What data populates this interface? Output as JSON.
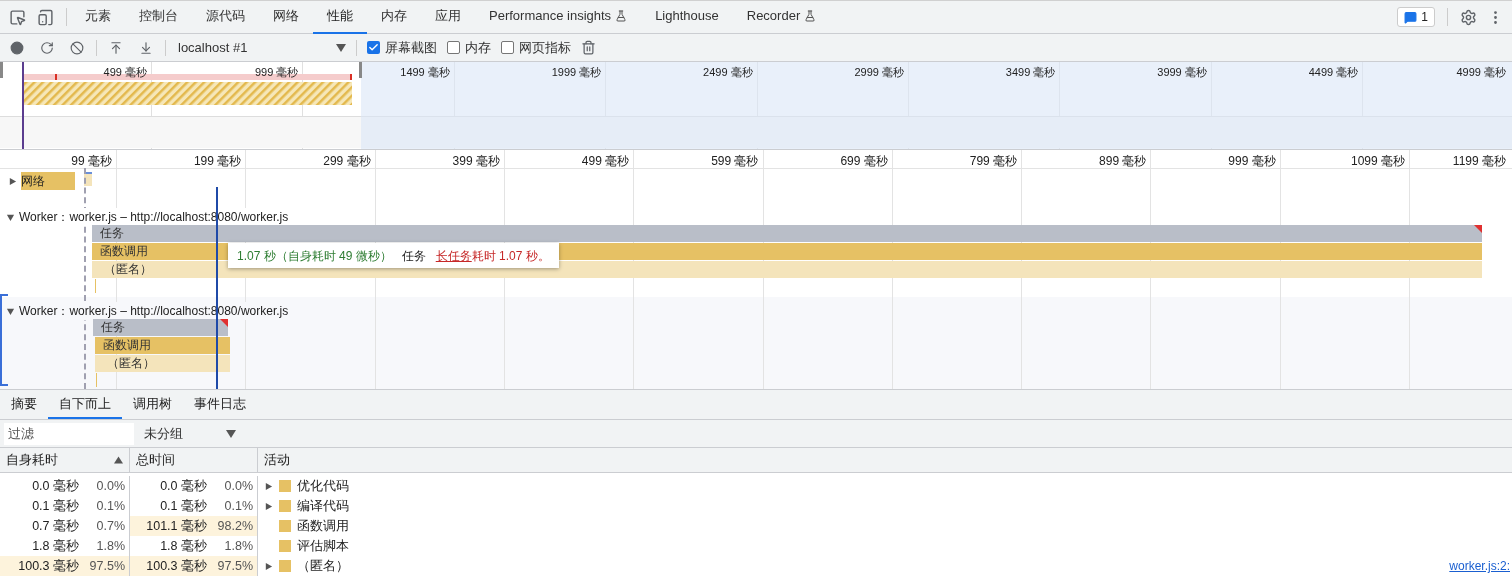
{
  "panel_tabs": [
    {
      "label": "元素",
      "selected": false,
      "experimental": false
    },
    {
      "label": "控制台",
      "selected": false,
      "experimental": false
    },
    {
      "label": "源代码",
      "selected": false,
      "experimental": false
    },
    {
      "label": "网络",
      "selected": false,
      "experimental": false
    },
    {
      "label": "性能",
      "selected": true,
      "experimental": false
    },
    {
      "label": "内存",
      "selected": false,
      "experimental": false
    },
    {
      "label": "应用",
      "selected": false,
      "experimental": false
    },
    {
      "label": "Performance insights",
      "selected": false,
      "experimental": true
    },
    {
      "label": "Lighthouse",
      "selected": false,
      "experimental": false
    },
    {
      "label": "Recorder",
      "selected": false,
      "experimental": true
    }
  ],
  "issues_count": "1",
  "toolbar": {
    "target": "localhost #1",
    "checkboxes": [
      {
        "label": "屏幕截图",
        "checked": true
      },
      {
        "label": "内存",
        "checked": false
      },
      {
        "label": "网页指标",
        "checked": false
      }
    ]
  },
  "overview": {
    "ticks": [
      "499 毫秒",
      "999 毫秒",
      "1499 毫秒",
      "1999 毫秒",
      "2499 毫秒",
      "2999 毫秒",
      "3499 毫秒",
      "3999 毫秒",
      "4499 毫秒",
      "4999 毫秒"
    ]
  },
  "flame_chart": {
    "ticks": [
      "99 毫秒",
      "199 毫秒",
      "299 毫秒",
      "399 毫秒",
      "499 毫秒",
      "599 毫秒",
      "699 毫秒",
      "799 毫秒",
      "899 毫秒",
      "999 毫秒",
      "1099 毫秒",
      "1199 毫秒"
    ],
    "network": {
      "label": "网络",
      "expanded": false
    },
    "workers": [
      {
        "title": "Worker：worker.js – http://localhost:8080/worker.js",
        "expanded": true,
        "selected": false,
        "events": [
          {
            "name": "任务",
            "kind": "task",
            "long_task": true
          },
          {
            "name": "函数调用",
            "kind": "function"
          },
          {
            "name": "（匿名）",
            "kind": "anonymous"
          }
        ]
      },
      {
        "title": "Worker：worker.js – http://localhost:8080/worker.js",
        "expanded": true,
        "selected": true,
        "events": [
          {
            "name": "任务",
            "kind": "task",
            "long_task": true
          },
          {
            "name": "函数调用",
            "kind": "function"
          },
          {
            "name": "（匿名）",
            "kind": "anonymous"
          }
        ]
      }
    ],
    "tooltip": {
      "duration": "1.07 秒（自身耗时 49 微秒）",
      "name": "任务",
      "link": "长任务",
      "warning": "耗时 1.07 秒。"
    }
  },
  "detail_tabs": [
    {
      "label": "摘要",
      "selected": false
    },
    {
      "label": "自下而上",
      "selected": true
    },
    {
      "label": "调用树",
      "selected": false
    },
    {
      "label": "事件日志",
      "selected": false
    }
  ],
  "filter": {
    "placeholder": "过滤",
    "grouping": "未分组"
  },
  "table": {
    "columns": [
      "自身耗时",
      "总时间",
      "活动"
    ],
    "rows": [
      {
        "self": "0.0 毫秒",
        "self_pct": "0.0%",
        "total": "0.0 毫秒",
        "total_pct": "0.0%",
        "activity": "优化代码",
        "expandable": true,
        "self_highlighted": false,
        "total_highlighted": false
      },
      {
        "self": "0.1 毫秒",
        "self_pct": "0.1%",
        "total": "0.1 毫秒",
        "total_pct": "0.1%",
        "activity": "编译代码",
        "expandable": true,
        "self_highlighted": false,
        "total_highlighted": false
      },
      {
        "self": "0.7 毫秒",
        "self_pct": "0.7%",
        "total": "101.1 毫秒",
        "total_pct": "98.2%",
        "activity": "函数调用",
        "expandable": false,
        "self_highlighted": false,
        "total_highlighted": true
      },
      {
        "self": "1.8 毫秒",
        "self_pct": "1.8%",
        "total": "1.8 毫秒",
        "total_pct": "1.8%",
        "activity": "评估脚本",
        "expandable": false,
        "self_highlighted": false,
        "total_highlighted": false
      },
      {
        "self": "100.3 毫秒",
        "self_pct": "97.5%",
        "total": "100.3 毫秒",
        "total_pct": "97.5%",
        "activity": "（匿名）",
        "expandable": true,
        "self_highlighted": true,
        "total_highlighted": true,
        "source": "worker.js:2:"
      }
    ]
  }
}
